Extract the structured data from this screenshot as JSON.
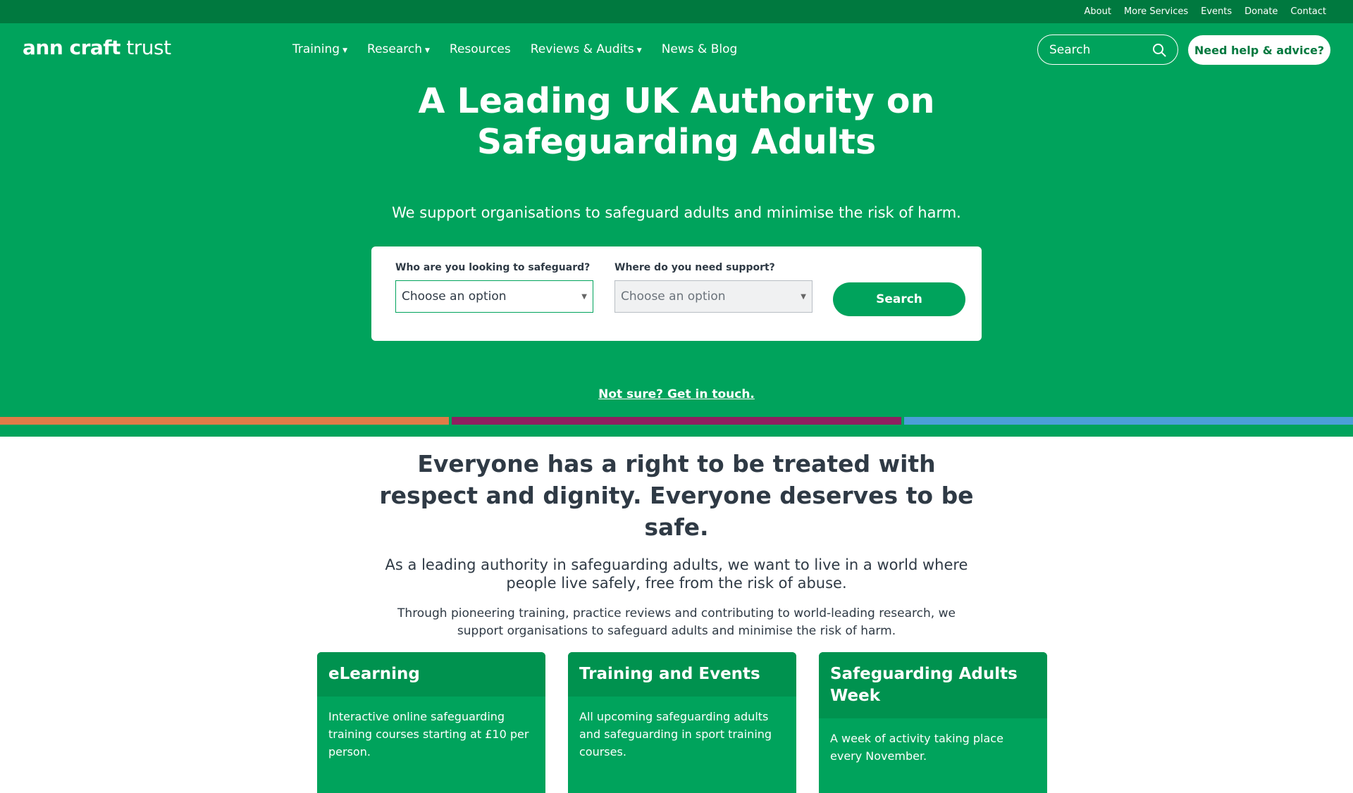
{
  "topbar": {
    "links": [
      "About",
      "More Services",
      "Events",
      "Donate",
      "Contact"
    ]
  },
  "logo": {
    "bold": "ann craft",
    "regular": " trust"
  },
  "nav": {
    "items": [
      {
        "label": "Training",
        "has_dropdown": true
      },
      {
        "label": "Research",
        "has_dropdown": true
      },
      {
        "label": "Resources",
        "has_dropdown": false
      },
      {
        "label": "Reviews & Audits",
        "has_dropdown": true
      },
      {
        "label": "News & Blog",
        "has_dropdown": false
      }
    ],
    "search_placeholder": "Search",
    "help_button": "Need help & advice?"
  },
  "hero": {
    "title": "A Leading UK Authority on Safeguarding Adults",
    "subtitle": "We support organisations to safeguard adults and minimise the risk of harm.",
    "finder": {
      "who_label": "Who are you looking to safeguard?",
      "who_value": "Choose an option",
      "where_label": "Where do you need support?",
      "where_value": "Choose an option",
      "search_button": "Search"
    },
    "not_sure_link": "Not sure? Get in touch."
  },
  "colors": {
    "brand_green": "#00a35c",
    "dark_green": "#00793f",
    "stripe_orange": "#e07b47",
    "stripe_purple": "#8e2060",
    "stripe_blue": "#4a9fd8"
  },
  "intro": {
    "heading": "Everyone has a right to be treated with respect and dignity. Everyone deserves to be safe.",
    "lead": "As a leading authority in safeguarding adults, we want to live in a world where people live safely, free from the risk of abuse.",
    "body": "Through pioneering training, practice reviews and contributing to world-leading research, we support organisations to safeguard adults and minimise the risk of harm."
  },
  "cards": [
    {
      "title": "eLearning",
      "text": "Interactive online safeguarding training courses starting at £10 per person."
    },
    {
      "title": "Training and Events",
      "text": "All upcoming safeguarding adults and safeguarding in sport training courses."
    },
    {
      "title": "Safeguarding Adults Week",
      "text": "A week of activity taking place every November."
    }
  ]
}
